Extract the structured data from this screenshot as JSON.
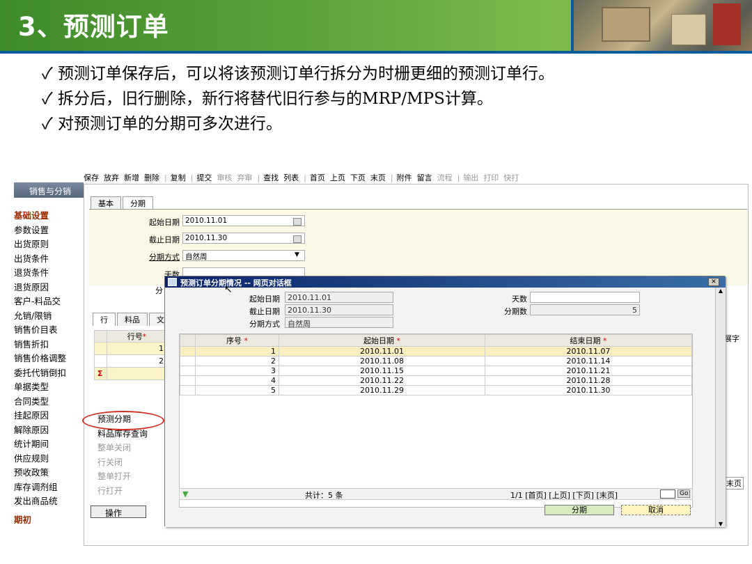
{
  "slide": {
    "title": "3、预测订单",
    "bullets": [
      "预测订单保存后，可以将该预测订单行拆分为时栅更细的预测订单行。",
      "拆分后，旧行删除，新行将替代旧行参与的MRP/MPS计算。",
      "对预测订单的分期可多次进行。"
    ],
    "bullet_mark": "✓"
  },
  "toolbar": {
    "items": [
      "保存",
      "放弃",
      "新增",
      "删除",
      "复制",
      "提交",
      "审核",
      "弃审",
      "查找",
      "列表",
      "首页",
      "上页",
      "下页",
      "末页",
      "附件",
      "留言",
      "流程",
      "输出",
      "打印",
      "快打"
    ]
  },
  "sidebar": {
    "header": "销售与分销",
    "items": [
      "基础设置",
      "参数设置",
      "出货原则",
      "出货条件",
      "退货条件",
      "退货原因",
      "客户-料品交",
      "允销/限销",
      "销售价目表",
      "销售折扣",
      "销售价格调整",
      "委托代销倒扣",
      "单据类型",
      "合同类型",
      "挂起原因",
      "解除原因",
      "统计期间",
      "供应规则",
      "预收政策",
      "库存调剂组",
      "发出商品统",
      "期初"
    ]
  },
  "main": {
    "tabs": [
      "基本",
      "分期"
    ],
    "form": {
      "start_label": "起始日期",
      "start_value": "2010.11.01",
      "end_label": "截止日期",
      "end_value": "2010.11.30",
      "method_label": "分期方式",
      "method_value": "自然周",
      "days_label": "天数",
      "count_label_partial": "分"
    },
    "grid_tabs": [
      "行",
      "料品",
      "文"
    ],
    "grid_header": "行号",
    "rows": [
      "1",
      "2"
    ],
    "sigma": "Σ",
    "right_partial": "展字",
    "right_partial2": "末页"
  },
  "menu": {
    "items": [
      "预测分期",
      "料品库存查询",
      "整单关闭",
      "行关闭",
      "整单打开",
      "行打开"
    ],
    "op_button": "操作"
  },
  "dialog": {
    "title": "预测订单分期情况 -- 网页对话框",
    "start_label": "起始日期",
    "start_value": "2010.11.01",
    "end_label": "截止日期",
    "end_value": "2010.11.30",
    "method_label": "分期方式",
    "method_value": "自然周",
    "days_label": "天数",
    "days_value": "",
    "count_label": "分期数",
    "count_value": "5",
    "columns": [
      "序号",
      "起始日期",
      "结束日期"
    ],
    "rows": [
      {
        "no": "1",
        "start": "2010.11.01",
        "end": "2010.11.07"
      },
      {
        "no": "2",
        "start": "2010.11.08",
        "end": "2010.11.14"
      },
      {
        "no": "3",
        "start": "2010.11.15",
        "end": "2010.11.21"
      },
      {
        "no": "4",
        "start": "2010.11.22",
        "end": "2010.11.28"
      },
      {
        "no": "5",
        "start": "2010.11.29",
        "end": "2010.11.30"
      }
    ],
    "total": "共计：5 条",
    "pager": "1/1 [首页] [上页] [下页] [末页]",
    "go": "Go",
    "split_button": "分期",
    "cancel_button": "取消"
  }
}
